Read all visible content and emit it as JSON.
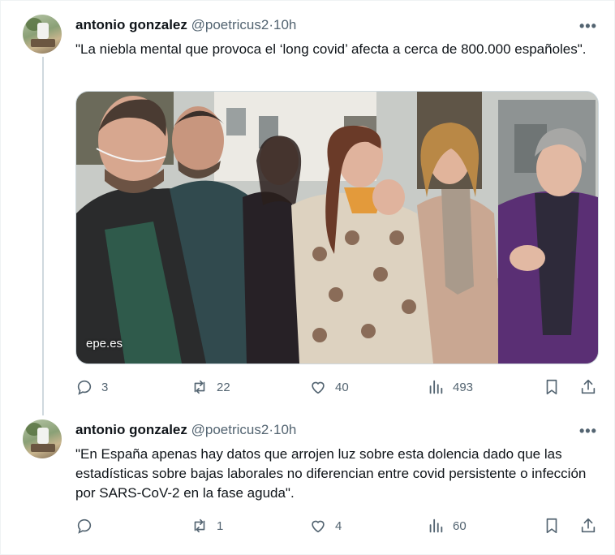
{
  "tweets": [
    {
      "author_name": "antonio gonzalez",
      "handle": "@poetricus2",
      "separator": "·",
      "time": "10h",
      "more": "•••",
      "text": "\"La niebla mental que provoca el ‘long covid’ afecta a cerca de 800.000 españoles\".",
      "media_label": "epe.es",
      "replies": "3",
      "retweets": "22",
      "likes": "40",
      "views": "493"
    },
    {
      "author_name": "antonio gonzalez",
      "handle": "@poetricus2",
      "separator": "·",
      "time": "10h",
      "more": "•••",
      "text": "\"En España apenas hay datos que arrojen luz sobre esta dolencia dado que las estadísticas sobre bajas laborales no diferencian entre covid persistente o infección por SARS-CoV-2 en la fase aguda\".",
      "replies": "",
      "retweets": "1",
      "likes": "4",
      "views": "60"
    }
  ],
  "icons": {
    "reply": "reply-icon",
    "retweet": "retweet-icon",
    "like": "heart-icon",
    "views": "views-chart-icon",
    "bookmark": "bookmark-icon",
    "share": "share-icon"
  },
  "colors": {
    "text": "#0f1419",
    "secondary": "#536471",
    "border": "#cfd9de"
  }
}
